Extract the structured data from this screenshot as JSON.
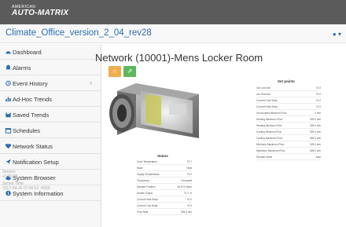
{
  "brand": {
    "line1": "AMERICAN",
    "line2": "AUTO-MATRIX"
  },
  "project": {
    "name": "Climate_Office_version_2_04_rev28"
  },
  "user_menu": {
    "icon": "user-icon",
    "label": "▾"
  },
  "sidebar": {
    "items": [
      {
        "label": "Dashboard",
        "icon": "dashboard-icon"
      },
      {
        "label": "Alarms",
        "icon": "bell-icon"
      },
      {
        "label": "Event History",
        "icon": "history-icon",
        "chevron": "‹"
      },
      {
        "label": "Ad-Hoc Trends",
        "icon": "chart-icon"
      },
      {
        "label": "Saved Trends",
        "icon": "save-icon"
      },
      {
        "label": "Schedules",
        "icon": "calendar-icon"
      },
      {
        "label": "Network Status",
        "icon": "heartbeat-icon"
      },
      {
        "label": "Notification Setup",
        "icon": "plane-icon"
      },
      {
        "label": "System Browser",
        "icon": "cloud-icon"
      },
      {
        "label": "System Information",
        "icon": "info-icon"
      }
    ],
    "version_label": "Version",
    "version_value": "v1.00.08",
    "server_time_label": "Server Time",
    "server_time_value": "2017-04-26 07:56:52 -0500"
  },
  "main": {
    "title": "Network (10001)-Mens Locker Room",
    "star_button": "☆",
    "share_button": "⇗"
  },
  "set_points": {
    "title": "Set points",
    "rows": [
      {
        "k": "Occ cool set",
        "v": "74.0"
      },
      {
        "k": "occ Heat set",
        "v": "70.0"
      },
      {
        "k": "Current Cool Setpt",
        "v": "74.0"
      },
      {
        "k": "Current Heat Setpt",
        "v": "70.0"
      },
      {
        "k": "Unoccupied Minimum Flow",
        "v": "0 cfm"
      },
      {
        "k": "Heating Maximum Flow",
        "v": "325.0 cfm"
      },
      {
        "k": "Heating Minimum Flow",
        "v": "325.0 cfm"
      },
      {
        "k": "Cooling Minimum Flow",
        "v": "325.0 cfm"
      },
      {
        "k": "Cooling Maximum Flow",
        "v": "650.0 cfm"
      },
      {
        "k": "Minimum Maximum Flow",
        "v": "325.0 cfm"
      },
      {
        "k": "Maximum Maximum Flow",
        "v": "325.0 cfm"
      },
      {
        "k": "Damper Mode",
        "v": "Auto"
      }
    ]
  },
  "status": {
    "title": "Status",
    "rows": [
      {
        "k": "Zone Temperature",
        "v": "70.7"
      },
      {
        "k": "Mode",
        "v": "Heat"
      },
      {
        "k": "Supply Temperature",
        "v": "70.2"
      },
      {
        "k": "Occupancy",
        "v": "Occupied"
      },
      {
        "k": "Damper Position",
        "v": "45.8 % Open"
      },
      {
        "k": "Heater Output",
        "v": "37.1 %"
      },
      {
        "k": "Current Heat Setpt",
        "v": "70.0"
      },
      {
        "k": "Current Cool Setpt",
        "v": "74.0"
      },
      {
        "k": "Flow Rate",
        "v": "325.0 cfm"
      }
    ]
  },
  "colors": {
    "topbar": "#5b5b5b",
    "link": "#2b6cb0",
    "star": "#f0ad4e",
    "share": "#5cb85c"
  }
}
